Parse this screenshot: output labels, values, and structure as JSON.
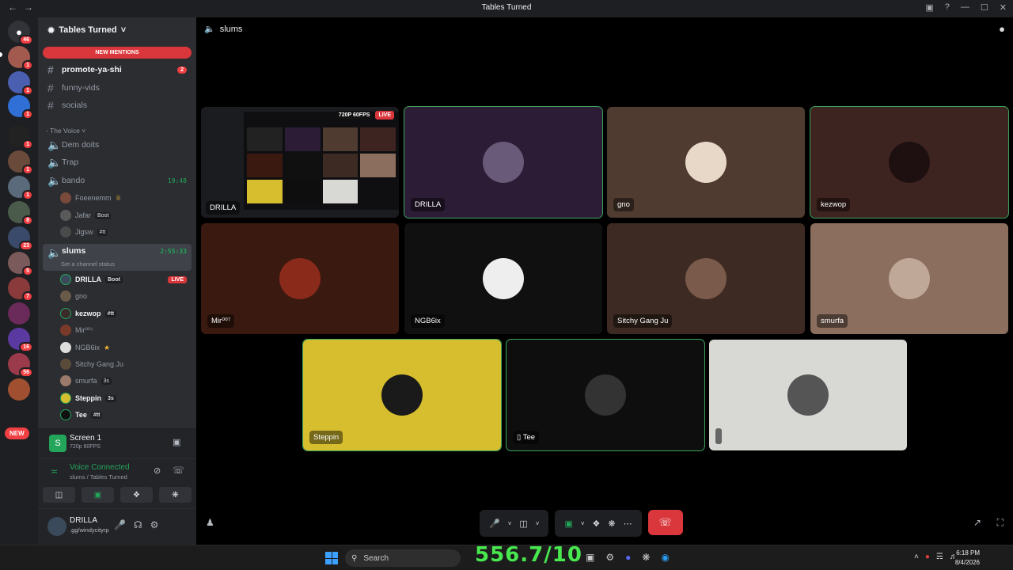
{
  "window": {
    "title": "Tables Turned"
  },
  "servers": {
    "home_badge": "46",
    "badges": [
      "1",
      "1",
      "1",
      "1",
      "1",
      "1",
      "8",
      "23",
      "5",
      "7",
      "16",
      "56"
    ],
    "new_label": "NEW"
  },
  "guild": {
    "name": "Tables Turned",
    "new_mentions": "NEW MENTIONS"
  },
  "text_channels": [
    {
      "name": "promote-ya-shi",
      "count": "2"
    },
    {
      "name": "funny-vids"
    },
    {
      "name": "socials"
    }
  ],
  "category": "- The Voice ˅",
  "voice_channels": [
    {
      "name": "Dem doits"
    },
    {
      "name": "Trap"
    },
    {
      "name": "bando",
      "timer": "19:48"
    },
    {
      "name": "slums",
      "timer": "2:55:33",
      "status": "Set a channel status"
    }
  ],
  "bando_users": [
    {
      "name": "Foeenemm",
      "tag": ""
    },
    {
      "name": "Jafar",
      "tag": "Boot"
    },
    {
      "name": "Jigsw",
      "tag": "#tt"
    }
  ],
  "slums_users": [
    {
      "name": "DRILLA",
      "tag": "Boot",
      "live": "LIVE"
    },
    {
      "name": "gno"
    },
    {
      "name": "kezwop",
      "tag": "#tt"
    },
    {
      "name": "Mir⁰⁰⁷"
    },
    {
      "name": "NGB6ix"
    },
    {
      "name": "Sitchy Gang Ju"
    },
    {
      "name": "smurfa",
      "tag": "3s"
    },
    {
      "name": "Steppin",
      "tag": "3s"
    },
    {
      "name": "Tee",
      "tag": "#tt"
    }
  ],
  "stream_panel": {
    "title": "Screen 1",
    "quality": "720p 60FPS"
  },
  "voice_status": {
    "label": "Voice Connected",
    "location": "slums / Tables Turned"
  },
  "user": {
    "name": "DRILLA",
    "status": ".gg/windycityrp"
  },
  "main": {
    "channel": "slums"
  },
  "tiles": [
    {
      "name": "DRILLA",
      "badge_quality": "720P 60FPS",
      "badge_live": "LIVE",
      "bg": "#1b1c20"
    },
    {
      "name": "DRILLA",
      "bg": "#2c1c36"
    },
    {
      "name": "gno",
      "bg": "#4f3b30"
    },
    {
      "name": "kezwop",
      "bg": "#3e2420"
    },
    {
      "name": "Mir⁰⁰⁷",
      "bg": "#3a1a10"
    },
    {
      "name": "NGB6ix",
      "bg": "#101010"
    },
    {
      "name": "Sitchy Gang Ju",
      "bg": "#3d2a22"
    },
    {
      "name": "smurfa",
      "bg": "#8b6e5d"
    },
    {
      "name": "Steppin",
      "bg": "#d6be2e"
    },
    {
      "name": "Tee",
      "bg": "#0e0e0e"
    },
    {
      "name": "",
      "bg": "#d8d8d4"
    }
  ],
  "taskbar": {
    "search": "Search",
    "overlay": "556.7/10",
    "time": "6:18 PM",
    "date": "8/4/2026"
  }
}
